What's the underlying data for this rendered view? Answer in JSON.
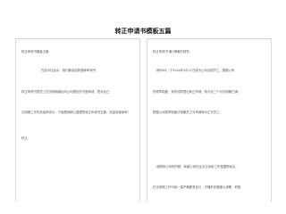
{
  "document": {
    "title": "转正申请书模板五篇"
  },
  "left_page": {
    "lines": [
      "转正申请书模板五篇",
      "在如今社会中，我们都会用到各种申请书，",
      "转正申请书是员工在试用期满后向公司提出的书面申请，是对自己",
      "试用期工作的总结和评价，下面是我精心整理的转正申请书五篇，欢迎阅读参考！",
      "转正。"
    ]
  },
  "right_page": {
    "lines": [
      "转正申请书 篇1尊敬的领导：",
      "我叫XX，于20xx年3月11日成为公司试用员工，根据公司",
      "的规章制度，现向领导提出转正申请，到今天三个月试用期已满。",
      "根据公司规章制度试用期员工可申请转为正式员工。",
      "我刚到公司的时候，就被公司的企业文化和工作氛围所吸引。",
      "在试用期工作中我一直严格要求自己，不懂的问题虚心请教，积极"
    ]
  }
}
